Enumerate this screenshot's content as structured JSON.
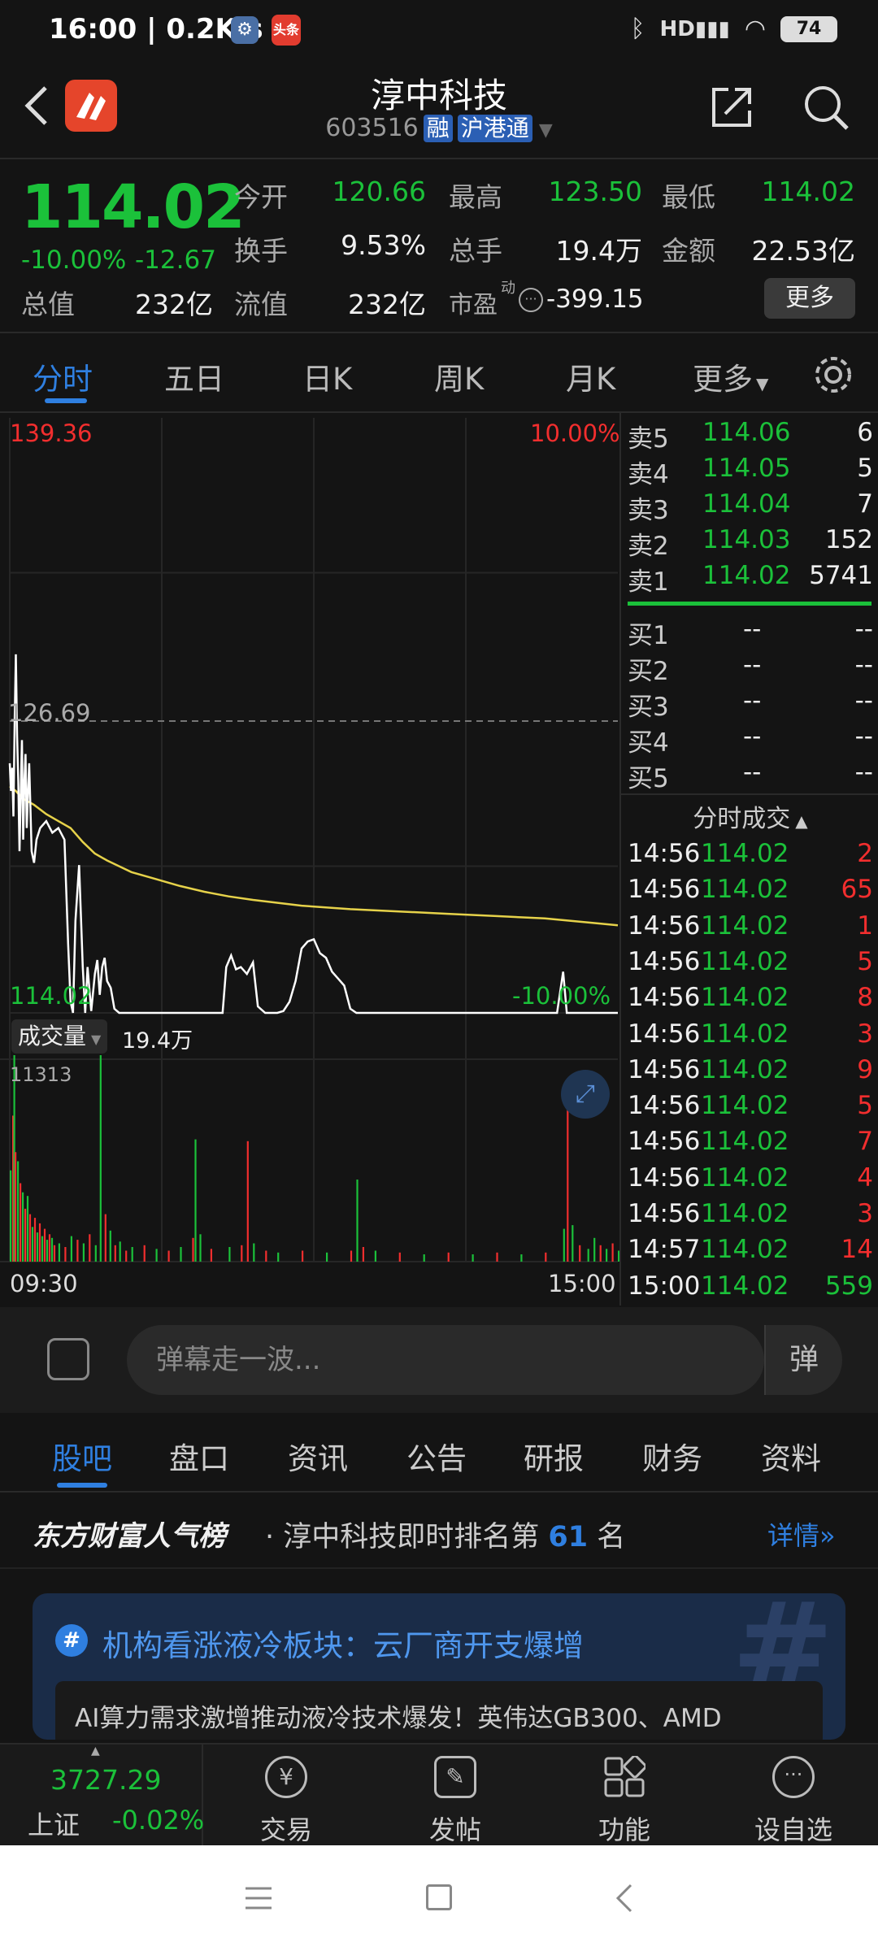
{
  "status_bar": {
    "time": "16:00 | 0.2K/s",
    "badge2": "头条",
    "battery": "74"
  },
  "header": {
    "title": "淳中科技",
    "code": "603516",
    "tag1": "融",
    "tag2": "沪港通"
  },
  "quote": {
    "price": "114.02",
    "change_pct": "-10.00%",
    "change": "-12.67",
    "open_label": "今开",
    "open": "120.66",
    "high_label": "最高",
    "high": "123.50",
    "low_label": "最低",
    "low": "114.02",
    "turnover_label": "换手",
    "turnover": "9.53%",
    "volume_label": "总手",
    "volume": "19.4万",
    "amount_label": "金额",
    "amount": "22.53亿",
    "mktcap_label": "总值",
    "mktcap": "232亿",
    "float_label": "流值",
    "float": "232亿",
    "pe_label": "市盈",
    "pe_sup": "动",
    "pe": "-399.15",
    "more_button": "更多"
  },
  "tabs": [
    "分时",
    "五日",
    "日K",
    "周K",
    "月K",
    "更多"
  ],
  "chart_data": {
    "type": "line",
    "price_axis": {
      "top": "139.36",
      "mid": "126.69",
      "bottom": "114.02",
      "top_pct": "10.00%",
      "bottom_pct": "-10.00%"
    },
    "time_axis": {
      "start": "09:30",
      "end": "15:00"
    },
    "volume_label": "成交量",
    "volume_total": "19.4万",
    "volume_max": "11313",
    "price_series": [
      [
        0,
        124.8
      ],
      [
        1,
        123.6
      ],
      [
        2,
        124.6
      ],
      [
        3,
        122.5
      ],
      [
        4,
        126.5
      ],
      [
        5,
        129.5
      ],
      [
        6,
        126
      ],
      [
        7,
        124
      ],
      [
        8,
        121
      ],
      [
        9,
        123.5
      ],
      [
        10,
        125.8
      ],
      [
        11,
        121.5
      ],
      [
        12,
        124
      ],
      [
        13,
        125.2
      ],
      [
        14,
        122
      ],
      [
        15,
        123.5
      ],
      [
        16,
        124.8
      ],
      [
        18,
        121
      ],
      [
        20,
        120.5
      ],
      [
        22,
        121.5
      ],
      [
        25,
        122
      ],
      [
        30,
        122.3
      ],
      [
        35,
        121.8
      ],
      [
        40,
        122
      ],
      [
        45,
        121.5
      ],
      [
        48,
        117
      ],
      [
        50,
        114.5
      ],
      [
        52,
        114.02
      ],
      [
        54,
        118
      ],
      [
        57,
        120.4
      ],
      [
        60,
        116
      ],
      [
        62,
        114.02
      ],
      [
        64,
        116
      ],
      [
        67,
        114.1
      ],
      [
        70,
        115.7
      ],
      [
        72,
        116.3
      ],
      [
        74,
        114.8
      ],
      [
        76,
        116
      ],
      [
        78,
        116.4
      ],
      [
        80,
        115.4
      ],
      [
        83,
        115.1
      ],
      [
        86,
        114.2
      ],
      [
        90,
        114.02
      ],
      [
        100,
        114.02
      ],
      [
        115,
        114.02
      ],
      [
        120,
        114.02
      ],
      [
        130,
        114.02
      ],
      [
        140,
        114.02
      ],
      [
        150,
        114.02
      ],
      [
        160,
        114.02
      ],
      [
        175,
        114.02
      ],
      [
        178,
        116
      ],
      [
        182,
        116.5
      ],
      [
        186,
        115.9
      ],
      [
        190,
        116
      ],
      [
        195,
        115.7
      ],
      [
        200,
        116.2
      ],
      [
        204,
        114.3
      ],
      [
        210,
        114.02
      ],
      [
        220,
        114.02
      ],
      [
        225,
        114.1
      ],
      [
        230,
        114.5
      ],
      [
        235,
        115.4
      ],
      [
        240,
        116.8
      ],
      [
        245,
        117.1
      ],
      [
        250,
        117.2
      ],
      [
        255,
        116.6
      ],
      [
        260,
        116.4
      ],
      [
        265,
        115.8
      ],
      [
        270,
        115.5
      ],
      [
        275,
        115.2
      ],
      [
        280,
        114.2
      ],
      [
        285,
        114.02
      ],
      [
        300,
        114.02
      ],
      [
        330,
        114.02
      ],
      [
        360,
        114.02
      ],
      [
        390,
        114.02
      ],
      [
        420,
        114.02
      ],
      [
        450,
        114.02
      ],
      [
        455,
        115.8
      ],
      [
        458,
        114.02
      ],
      [
        470,
        114.02
      ],
      [
        500,
        114.02
      ]
    ],
    "avg_series": [
      [
        0,
        123.8
      ],
      [
        5,
        123.6
      ],
      [
        10,
        123.3
      ],
      [
        20,
        123.0
      ],
      [
        30,
        122.6
      ],
      [
        40,
        122.3
      ],
      [
        50,
        122.0
      ],
      [
        60,
        121.4
      ],
      [
        70,
        120.9
      ],
      [
        80,
        120.6
      ],
      [
        90,
        120.35
      ],
      [
        100,
        120.1
      ],
      [
        120,
        119.8
      ],
      [
        140,
        119.5
      ],
      [
        160,
        119.25
      ],
      [
        180,
        119.05
      ],
      [
        200,
        118.9
      ],
      [
        240,
        118.65
      ],
      [
        280,
        118.5
      ],
      [
        320,
        118.4
      ],
      [
        360,
        118.3
      ],
      [
        400,
        118.2
      ],
      [
        440,
        118.1
      ],
      [
        480,
        117.9
      ],
      [
        500,
        117.8
      ]
    ],
    "volume_series": [
      [
        0,
        5000,
        "g"
      ],
      [
        2,
        8000,
        "r"
      ],
      [
        3,
        11313,
        "g"
      ],
      [
        4,
        6000,
        "r"
      ],
      [
        6,
        5500,
        "g"
      ],
      [
        8,
        4300,
        "r"
      ],
      [
        10,
        3800,
        "g"
      ],
      [
        12,
        2900,
        "r"
      ],
      [
        14,
        3600,
        "g"
      ],
      [
        16,
        2600,
        "r"
      ],
      [
        18,
        1900,
        "g"
      ],
      [
        20,
        2400,
        "r"
      ],
      [
        22,
        1600,
        "g"
      ],
      [
        24,
        2100,
        "r"
      ],
      [
        26,
        1400,
        "g"
      ],
      [
        28,
        1800,
        "r"
      ],
      [
        30,
        1200,
        "g"
      ],
      [
        32,
        1500,
        "r"
      ],
      [
        34,
        1300,
        "g"
      ],
      [
        36,
        900,
        "r"
      ],
      [
        40,
        1000,
        "g"
      ],
      [
        45,
        800,
        "r"
      ],
      [
        50,
        1400,
        "g"
      ],
      [
        55,
        1200,
        "r"
      ],
      [
        60,
        1000,
        "g"
      ],
      [
        65,
        1500,
        "r"
      ],
      [
        70,
        900,
        "g"
      ],
      [
        74,
        11313,
        "g"
      ],
      [
        78,
        2600,
        "r"
      ],
      [
        82,
        1700,
        "g"
      ],
      [
        86,
        900,
        "r"
      ],
      [
        90,
        1100,
        "g"
      ],
      [
        95,
        600,
        "r"
      ],
      [
        100,
        800,
        "g"
      ],
      [
        110,
        900,
        "r"
      ],
      [
        120,
        700,
        "g"
      ],
      [
        130,
        600,
        "r"
      ],
      [
        140,
        800,
        "g"
      ],
      [
        150,
        1300,
        "r"
      ],
      [
        152,
        6700,
        "g"
      ],
      [
        156,
        1500,
        "g"
      ],
      [
        165,
        700,
        "r"
      ],
      [
        180,
        800,
        "g"
      ],
      [
        190,
        900,
        "r"
      ],
      [
        195,
        6600,
        "r"
      ],
      [
        200,
        1000,
        "g"
      ],
      [
        210,
        600,
        "r"
      ],
      [
        220,
        500,
        "g"
      ],
      [
        240,
        600,
        "r"
      ],
      [
        260,
        500,
        "g"
      ],
      [
        280,
        600,
        "r"
      ],
      [
        285,
        4500,
        "g"
      ],
      [
        290,
        800,
        "r"
      ],
      [
        300,
        600,
        "g"
      ],
      [
        320,
        500,
        "r"
      ],
      [
        340,
        400,
        "g"
      ],
      [
        360,
        500,
        "r"
      ],
      [
        380,
        400,
        "g"
      ],
      [
        400,
        500,
        "r"
      ],
      [
        420,
        400,
        "g"
      ],
      [
        440,
        500,
        "r"
      ],
      [
        455,
        1800,
        "g"
      ],
      [
        458,
        8300,
        "r"
      ],
      [
        462,
        2000,
        "g"
      ],
      [
        468,
        900,
        "r"
      ],
      [
        475,
        700,
        "g"
      ],
      [
        480,
        1300,
        "g"
      ],
      [
        485,
        900,
        "r"
      ],
      [
        490,
        700,
        "g"
      ],
      [
        495,
        1000,
        "r"
      ],
      [
        500,
        600,
        "g"
      ]
    ]
  },
  "order_book": {
    "asks": [
      {
        "label": "卖5",
        "price": "114.06",
        "qty": "6"
      },
      {
        "label": "卖4",
        "price": "114.05",
        "qty": "5"
      },
      {
        "label": "卖3",
        "price": "114.04",
        "qty": "7"
      },
      {
        "label": "卖2",
        "price": "114.03",
        "qty": "152"
      },
      {
        "label": "卖1",
        "price": "114.02",
        "qty": "5741"
      }
    ],
    "bids": [
      {
        "label": "买1",
        "price": "--",
        "qty": "--"
      },
      {
        "label": "买2",
        "price": "--",
        "qty": "--"
      },
      {
        "label": "买3",
        "price": "--",
        "qty": "--"
      },
      {
        "label": "买4",
        "price": "--",
        "qty": "--"
      },
      {
        "label": "买5",
        "price": "--",
        "qty": "--"
      }
    ],
    "trades_title": "分时成交",
    "trades": [
      {
        "time": "14:56",
        "price": "114.02",
        "qty": "2",
        "color": "red"
      },
      {
        "time": "14:56",
        "price": "114.02",
        "qty": "65",
        "color": "red"
      },
      {
        "time": "14:56",
        "price": "114.02",
        "qty": "1",
        "color": "red"
      },
      {
        "time": "14:56",
        "price": "114.02",
        "qty": "5",
        "color": "red"
      },
      {
        "time": "14:56",
        "price": "114.02",
        "qty": "8",
        "color": "red"
      },
      {
        "time": "14:56",
        "price": "114.02",
        "qty": "3",
        "color": "red"
      },
      {
        "time": "14:56",
        "price": "114.02",
        "qty": "9",
        "color": "red"
      },
      {
        "time": "14:56",
        "price": "114.02",
        "qty": "5",
        "color": "red"
      },
      {
        "time": "14:56",
        "price": "114.02",
        "qty": "7",
        "color": "red"
      },
      {
        "time": "14:56",
        "price": "114.02",
        "qty": "4",
        "color": "red"
      },
      {
        "time": "14:56",
        "price": "114.02",
        "qty": "3",
        "color": "red"
      },
      {
        "time": "14:57",
        "price": "114.02",
        "qty": "14",
        "color": "red"
      },
      {
        "time": "15:00",
        "price": "114.02",
        "qty": "559",
        "color": "green"
      }
    ]
  },
  "danmu": {
    "placeholder": "弹幕走一波...",
    "send": "弹"
  },
  "subtabs": [
    "股吧",
    "盘口",
    "资讯",
    "公告",
    "研报",
    "财务",
    "资料"
  ],
  "rank": {
    "brand": "东方财富人气榜",
    "text": "· 淳中科技即时排名第",
    "num": "61",
    "suffix": "名",
    "detail": "详情"
  },
  "card": {
    "title": "机构看涨液冷板块：云厂商开支爆增",
    "body": "AI算力需求激增推动液冷技术爆发！英伟达GB300、AMD"
  },
  "bottom_nav": {
    "index_value": "3727.29",
    "index_name": "上证",
    "index_change": "-0.02%",
    "items": [
      "交易",
      "发帖",
      "功能",
      "设自选"
    ]
  },
  "colors": {
    "up": "#f22e2e",
    "down": "#1bc13a",
    "accent": "#2f7fe0",
    "avg_line": "#e6d24a"
  }
}
